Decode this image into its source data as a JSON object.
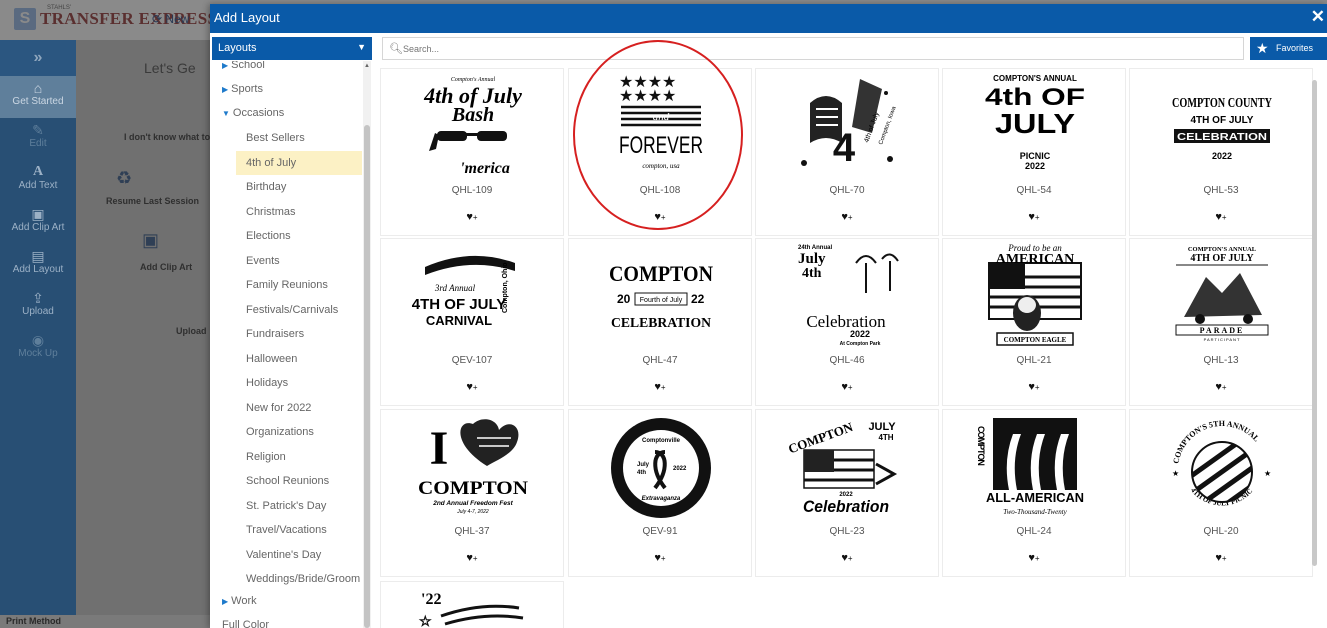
{
  "app": {
    "brand": "TRANSFER EXPRESS",
    "brand_tag": "STAHLS'",
    "new_label": "New",
    "sidebar": [
      {
        "icon": "home-icon",
        "label": "Get Started",
        "active": true,
        "disabled": false
      },
      {
        "icon": "pencil-icon",
        "label": "Edit",
        "active": false,
        "disabled": true
      },
      {
        "icon": "text-icon",
        "label": "Add Text",
        "active": false,
        "disabled": false
      },
      {
        "icon": "image-icon",
        "label": "Add Clip Art",
        "active": false,
        "disabled": false
      },
      {
        "icon": "layout-icon",
        "label": "Add Layout",
        "active": false,
        "disabled": false
      },
      {
        "icon": "upload-icon",
        "label": "Upload",
        "active": false,
        "disabled": false
      },
      {
        "icon": "eye-icon",
        "label": "Mock Up",
        "active": false,
        "disabled": true
      }
    ],
    "main": {
      "heading": "Let's Ge",
      "dont_know": "I don't know what to",
      "resume": "Resume Last Session",
      "add_clip_art": "Add Clip Art",
      "upload": "Upload"
    },
    "print_method": "Print Method"
  },
  "modal": {
    "title": "Add Layout",
    "close": "✕",
    "category_select": "Layouts",
    "search_placeholder": "Search...",
    "favorites_label": "Favorites",
    "categories": {
      "school": "School",
      "sports": "Sports",
      "occasions": "Occasions",
      "children": [
        "Best Sellers",
        "4th of July",
        "Birthday",
        "Christmas",
        "Elections",
        "Events",
        "Family Reunions",
        "Festivals/Carnivals",
        "Fundraisers",
        "Halloween",
        "Holidays",
        "New for 2022",
        "Organizations",
        "Religion",
        "School Reunions",
        "St. Patrick's Day",
        "Travel/Vacations",
        "Valentine's Day",
        "Weddings/Bride/Groom"
      ],
      "selected": "4th of July",
      "work": "Work",
      "full_color": "Full Color"
    },
    "favorite_glyph": "♥",
    "favorite_plus": "+",
    "layouts": [
      {
        "code": "QHL-109",
        "lines": [
          "Compton's Annual",
          "4th of July",
          "Bash",
          "'merica"
        ]
      },
      {
        "code": "QHL-108",
        "lines": [
          "and",
          "FOREVER",
          "compton, usa"
        ]
      },
      {
        "code": "QHL-70",
        "lines": [
          "4",
          "4th of July",
          "Compton, Iowa"
        ]
      },
      {
        "code": "QHL-54",
        "lines": [
          "COMPTON'S ANNUAL",
          "4th OF",
          "JULY",
          "PICNIC",
          "2022"
        ]
      },
      {
        "code": "QHL-53",
        "lines": [
          "COMPTON COUNTY",
          "4TH OF JULY",
          "CELEBRATION",
          "2022"
        ]
      },
      {
        "code": "QEV-107",
        "lines": [
          "3rd Annual",
          "4TH OF JULY",
          "CARNIVAL",
          "Compton, Ohio"
        ]
      },
      {
        "code": "QHL-47",
        "lines": [
          "COMPTON",
          "20",
          "Fourth of July",
          "22",
          "CELEBRATION"
        ]
      },
      {
        "code": "QHL-46",
        "lines": [
          "24th Annual",
          "July",
          "4th",
          "Celebration",
          "2022",
          "At Compton Park"
        ]
      },
      {
        "code": "QHL-21",
        "lines": [
          "Proud to be an",
          "AMERICAN",
          "COMPTON EAGLE"
        ]
      },
      {
        "code": "QHL-13",
        "lines": [
          "COMPTON'S ANNUAL",
          "4TH OF JULY",
          "PARADE",
          "PARTICIPANT"
        ]
      },
      {
        "code": "QHL-37",
        "lines": [
          "I",
          "COMPTON",
          "2nd Annual Freedom Fest",
          "July 4-7, 2022"
        ]
      },
      {
        "code": "QEV-91",
        "lines": [
          "Comptonville",
          "July",
          "4th",
          "2022",
          "Extravaganza"
        ]
      },
      {
        "code": "QHL-23",
        "lines": [
          "COMPTON",
          "JULY",
          "4TH",
          "2022",
          "Celebration"
        ]
      },
      {
        "code": "QHL-24",
        "lines": [
          "COMPTON",
          "ALL-AMERICAN",
          "Two-Thousand-Twenty"
        ]
      },
      {
        "code": "QHL-20",
        "lines": [
          "COMPTON'S 5TH ANNUAL",
          "4TH OF JULY PICNIC"
        ]
      },
      {
        "code": "",
        "lines": [
          "'22"
        ]
      }
    ]
  },
  "colors": {
    "accent": "#0a5aa8",
    "selected_row": "#fcf1c5",
    "annotation": "#d62020",
    "sidebar": "#284f74"
  }
}
